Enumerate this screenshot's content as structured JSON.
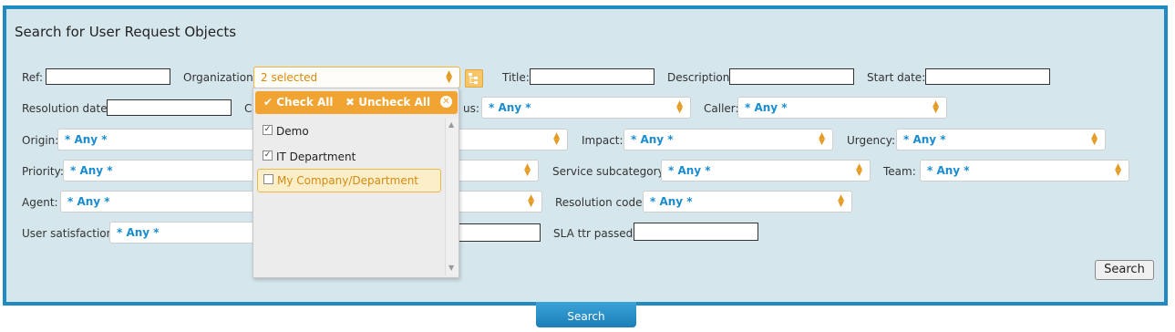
{
  "title": "Search for User Request Objects",
  "row1": {
    "ref_label": "Ref:",
    "org_label": "Organization:",
    "org_value": "2 selected",
    "title_label": "Title:",
    "description_label": "Description:",
    "start_date_label": "Start date:"
  },
  "row2": {
    "resolution_date_label": "Resolution date:",
    "partial_c": "C",
    "partial_status": "us:",
    "status_value": "* Any *",
    "caller_label": "Caller:",
    "caller_value": "* Any *"
  },
  "row3": {
    "origin_label": "Origin:",
    "origin_value": "* Any *",
    "impact_label": "Impact:",
    "impact_value": "* Any *",
    "urgency_label": "Urgency:",
    "urgency_value": "* Any *"
  },
  "row4": {
    "priority_label": "Priority:",
    "priority_value": "* Any *",
    "service_subcategory_label": "Service subcategory:",
    "service_subcategory_value": "* Any *",
    "team_label": "Team:",
    "team_value": "* Any *"
  },
  "row5": {
    "agent_label": "Agent:",
    "agent_value": "* Any *",
    "resolution_code_label": "Resolution code:",
    "resolution_code_value": "* Any *"
  },
  "row6": {
    "user_satisfaction_label": "User satisfaction:",
    "user_satisfaction_value": "* Any *",
    "sla_ttr_passed_label": "SLA ttr passed:"
  },
  "dropdown": {
    "check_all": "✔ Check All",
    "uncheck_all": "✖ Uncheck All",
    "options": [
      {
        "label": "Demo",
        "checked": true
      },
      {
        "label": "IT Department",
        "checked": true
      },
      {
        "label": "My Company/Department",
        "checked": false
      }
    ]
  },
  "search_button": "Search",
  "search_tab": "Search",
  "colors": {
    "accent": "#1f8bc2",
    "panel": "#d5e6ed",
    "orange": "#f2a432",
    "link_blue": "#1a8ccf"
  }
}
